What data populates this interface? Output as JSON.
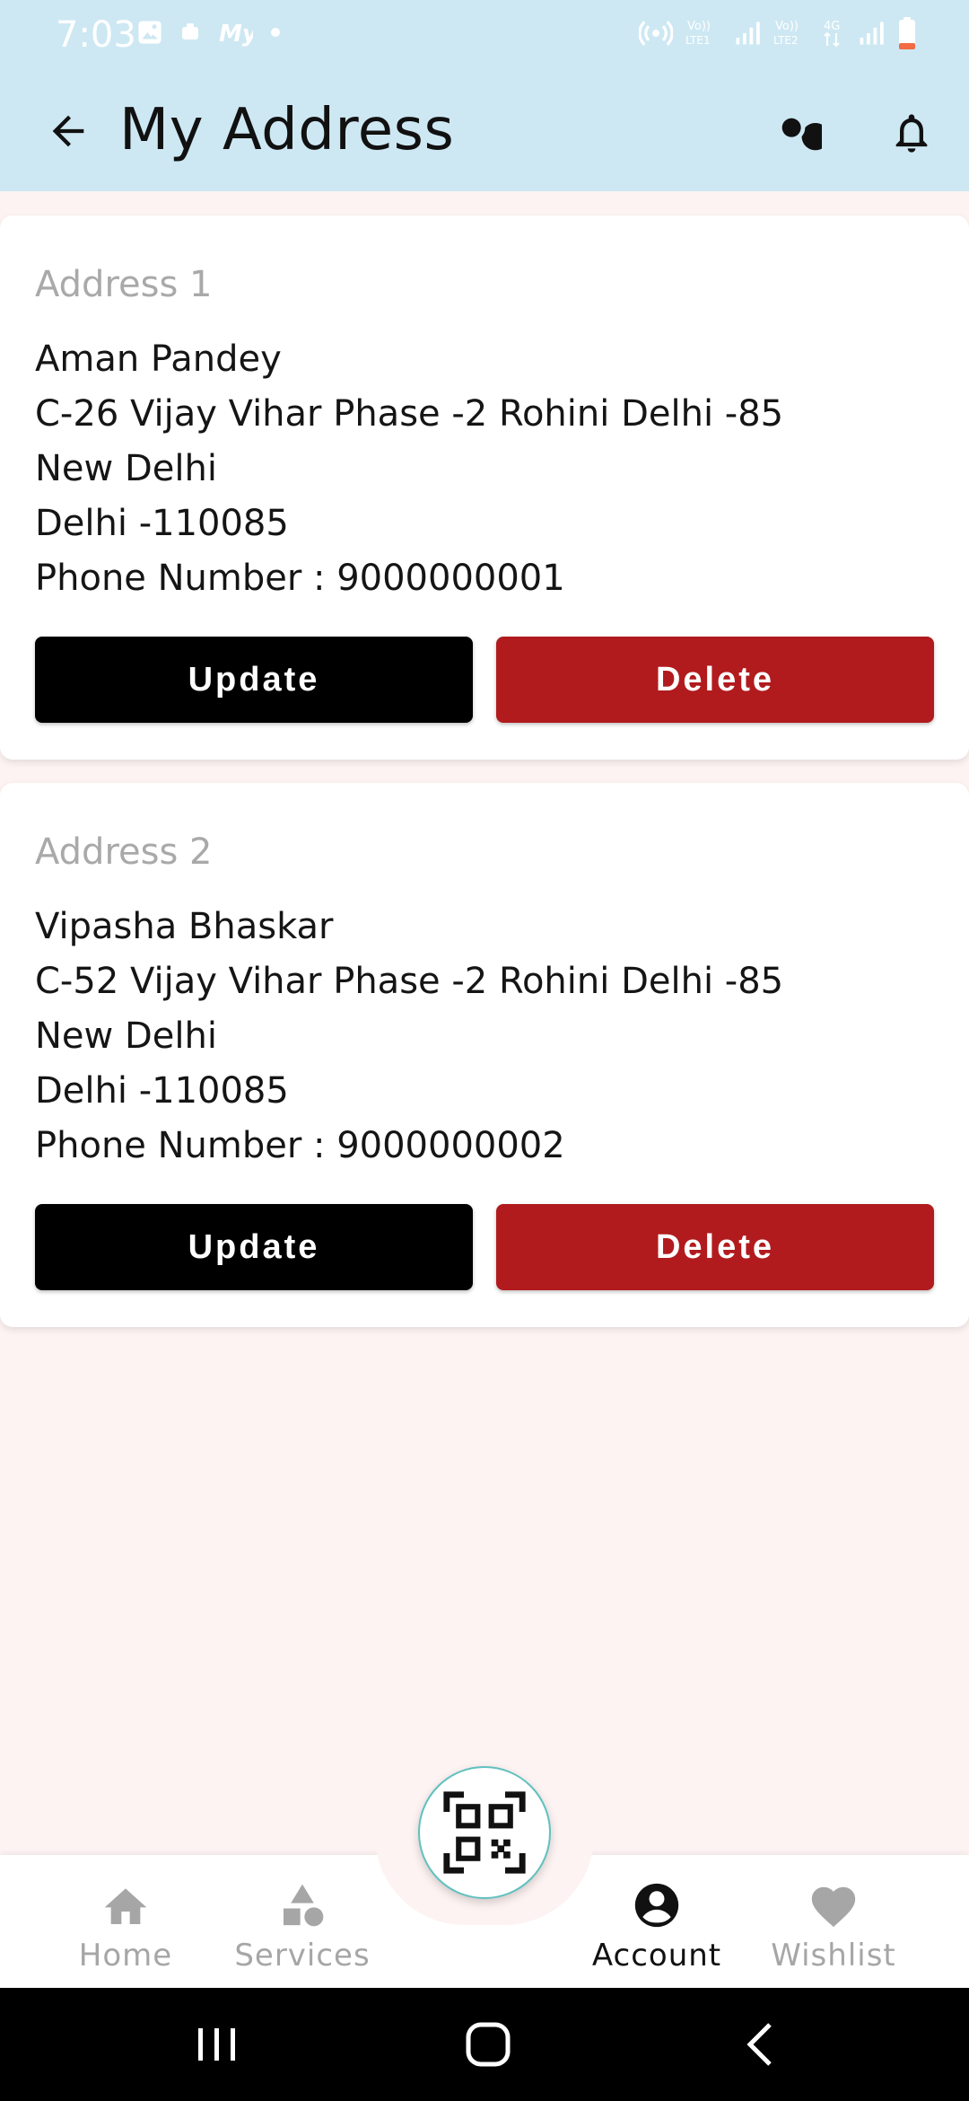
{
  "status_bar": {
    "time": "7:03",
    "left_icons": [
      "image-icon",
      "notification-icon",
      "myjio-icon",
      "dot-icon"
    ],
    "right_icons": [
      "hotspot-icon",
      "volte-lte1-icon",
      "signal-icon",
      "volte-lte2-icon",
      "4g-icon",
      "signal-icon",
      "battery-icon"
    ],
    "lte1": "Vo)) LTE1",
    "lte2": "Vo)) LTE2",
    "net": "4G"
  },
  "header": {
    "title": "My Address",
    "back_icon": "arrow-left-icon",
    "search_icon": "search-icon",
    "bell_icon": "bell-icon"
  },
  "addresses": [
    {
      "label": "Address 1",
      "name": "Aman Pandey",
      "street": "C-26 Vijay Vihar Phase -2 Rohini Delhi -85",
      "city": "New Delhi",
      "state_pin": "Delhi -110085",
      "phone": "Phone Number : 9000000001",
      "update_label": "Update",
      "delete_label": "Delete"
    },
    {
      "label": "Address 2",
      "name": "Vipasha Bhaskar",
      "street": "C-52 Vijay Vihar Phase -2 Rohini Delhi -85",
      "city": "New Delhi",
      "state_pin": "Delhi -110085",
      "phone": "Phone Number : 9000000002",
      "update_label": "Update",
      "delete_label": "Delete"
    }
  ],
  "bottom_nav": {
    "items": [
      {
        "label": "Home",
        "icon": "home-icon",
        "active": false
      },
      {
        "label": "Services",
        "icon": "shapes-icon",
        "active": false
      },
      {
        "label": "Account",
        "icon": "account-icon",
        "active": true
      },
      {
        "label": "Wishlist",
        "icon": "heart-icon",
        "active": false
      }
    ],
    "fab_icon": "qr-scan-icon"
  },
  "colors": {
    "header_bg": "#cde8f3",
    "page_bg": "#fdf3f2",
    "update_bg": "#000000",
    "delete_bg": "#b11b1d",
    "fab_border": "#5fc1c0"
  }
}
